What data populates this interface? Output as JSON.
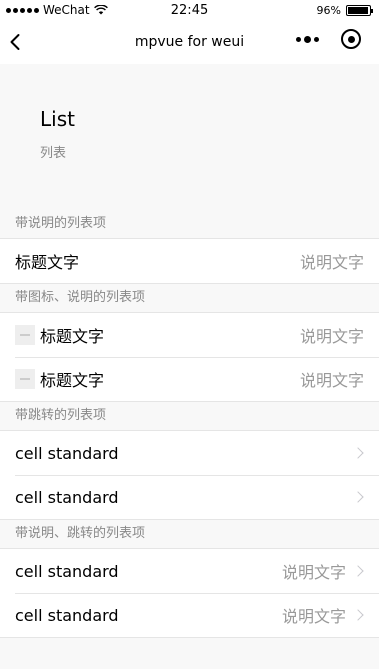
{
  "status_bar": {
    "carrier": "WeChat",
    "time": "22:45",
    "battery_percent": "96%",
    "battery_level": 0.96
  },
  "nav": {
    "title": "mpvue for weui"
  },
  "header": {
    "title": "List",
    "desc": "列表"
  },
  "groups": [
    {
      "title": "带说明的列表项",
      "cells": [
        {
          "label": "标题文字",
          "value": "说明文字"
        }
      ]
    },
    {
      "title": "带图标、说明的列表项",
      "cells": [
        {
          "label": "标题文字",
          "value": "说明文字"
        },
        {
          "label": "标题文字",
          "value": "说明文字"
        }
      ]
    },
    {
      "title": "带跳转的列表项",
      "cells": [
        {
          "label": "cell standard"
        },
        {
          "label": "cell standard"
        }
      ]
    },
    {
      "title": "带说明、跳转的列表项",
      "cells": [
        {
          "label": "cell standard",
          "value": "说明文字"
        },
        {
          "label": "cell standard",
          "value": "说明文字"
        }
      ]
    }
  ]
}
